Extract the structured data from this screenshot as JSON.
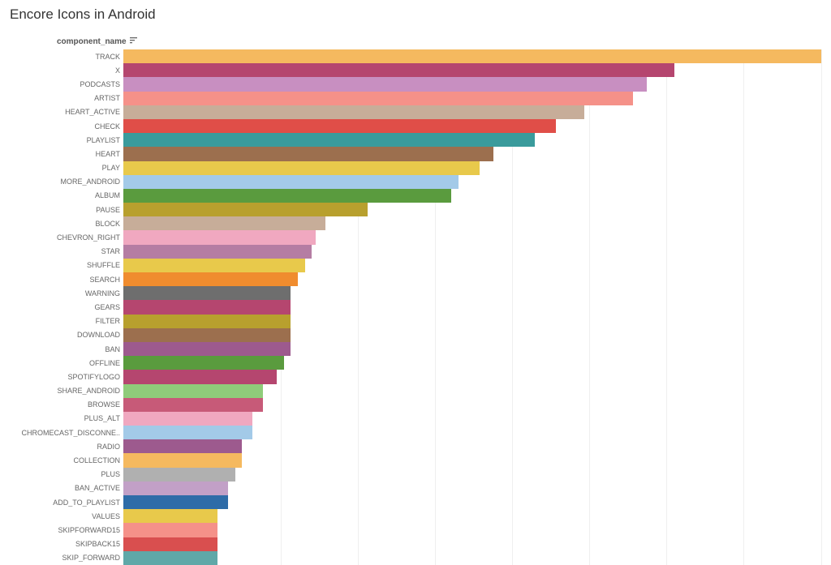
{
  "title": "Encore Icons in Android",
  "axis_label": "component_name",
  "chart_data": {
    "type": "bar",
    "orientation": "horizontal",
    "title": "Encore Icons in Android",
    "xlabel": "",
    "ylabel": "component_name",
    "xlim": [
      0,
      100
    ],
    "categories": [
      "TRACK",
      "X",
      "PODCASTS",
      "ARTIST",
      "HEART_ACTIVE",
      "CHECK",
      "PLAYLIST",
      "HEART",
      "PLAY",
      "MORE_ANDROID",
      "ALBUM",
      "PAUSE",
      "BLOCK",
      "CHEVRON_RIGHT",
      "STAR",
      "SHUFFLE",
      "SEARCH",
      "WARNING",
      "GEARS",
      "FILTER",
      "DOWNLOAD",
      "BAN",
      "OFFLINE",
      "SPOTIFYLOGO",
      "SHARE_ANDROID",
      "BROWSE",
      "PLUS_ALT",
      "CHROMECAST_DISCONNE..",
      "RADIO",
      "COLLECTION",
      "PLUS",
      "BAN_ACTIVE",
      "ADD_TO_PLAYLIST",
      "VALUES",
      "SKIPFORWARD15",
      "SKIPBACK15",
      "SKIP_FORWARD"
    ],
    "values": [
      100,
      79,
      75,
      73,
      66,
      62,
      59,
      53,
      51,
      48,
      47,
      35,
      29,
      27.5,
      27,
      26,
      25,
      24,
      24,
      24,
      24,
      24,
      23,
      22,
      20,
      20,
      18.5,
      18.5,
      17,
      17,
      16,
      15,
      15,
      13.5,
      13.5,
      13.5,
      13.5
    ],
    "colors": [
      "#f5b95f",
      "#b5466f",
      "#c88fc1",
      "#f59189",
      "#c7ad99",
      "#e04e48",
      "#3a9b9c",
      "#9c6f4e",
      "#e8c94b",
      "#a3cae8",
      "#5a9b3e",
      "#b8a02e",
      "#c7ad99",
      "#f0a8c0",
      "#b57da3",
      "#e8c94b",
      "#f08c2e",
      "#6e6e6e",
      "#b5466f",
      "#b8a02e",
      "#9c6f4e",
      "#9d5a8e",
      "#5a9b3e",
      "#b5466f",
      "#8fcc7a",
      "#c75a78",
      "#f0a8c0",
      "#a3cae8",
      "#9d5a8e",
      "#f5b95f",
      "#b0b0b0",
      "#c2a0c7",
      "#2e6ca8",
      "#e8c94b",
      "#f59189",
      "#d94f4f",
      "#5fa8a8"
    ]
  },
  "gridline_positions": [
    11.1,
    22.2,
    33.3,
    44.4,
    55.5,
    66.6,
    77.7,
    88.8,
    100
  ]
}
